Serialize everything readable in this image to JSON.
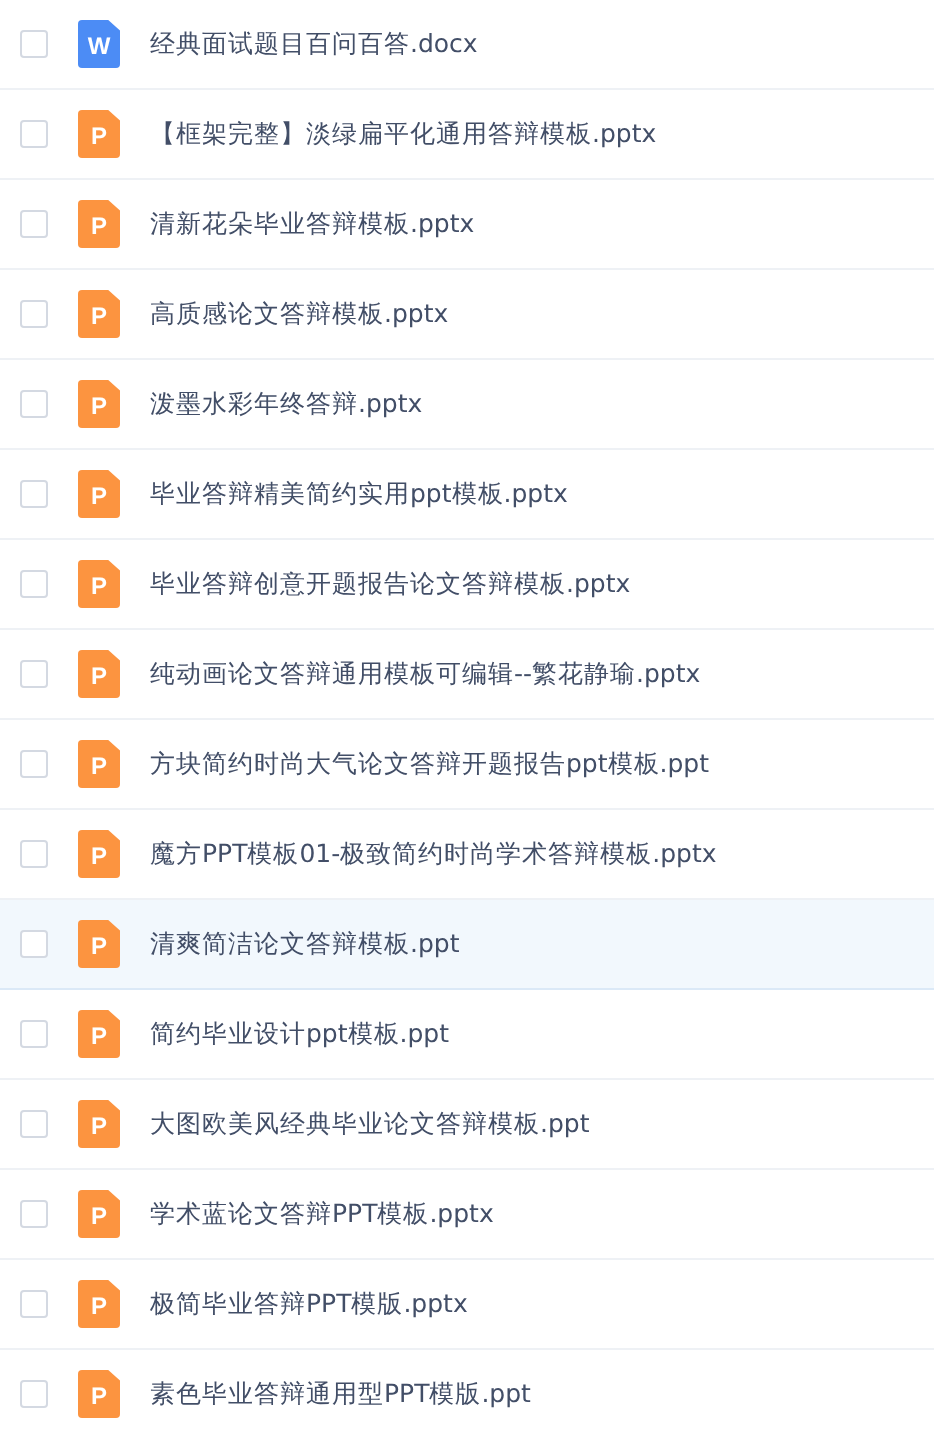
{
  "files": [
    {
      "name": "经典面试题目百问百答.docx",
      "kind": "word",
      "badge": "W",
      "checked": false,
      "selected": false
    },
    {
      "name": "【框架完整】淡绿扁平化通用答辩模板.pptx",
      "kind": "ppt",
      "badge": "P",
      "checked": false,
      "selected": false
    },
    {
      "name": "清新花朵毕业答辩模板.pptx",
      "kind": "ppt",
      "badge": "P",
      "checked": false,
      "selected": false
    },
    {
      "name": "高质感论文答辩模板.pptx",
      "kind": "ppt",
      "badge": "P",
      "checked": false,
      "selected": false
    },
    {
      "name": "泼墨水彩年终答辩.pptx",
      "kind": "ppt",
      "badge": "P",
      "checked": false,
      "selected": false
    },
    {
      "name": "毕业答辩精美简约实用ppt模板.pptx",
      "kind": "ppt",
      "badge": "P",
      "checked": false,
      "selected": false
    },
    {
      "name": "毕业答辩创意开题报告论文答辩模板.pptx",
      "kind": "ppt",
      "badge": "P",
      "checked": false,
      "selected": false
    },
    {
      "name": "纯动画论文答辩通用模板可编辑--繁花静瑜.pptx",
      "kind": "ppt",
      "badge": "P",
      "checked": false,
      "selected": false
    },
    {
      "name": "方块简约时尚大气论文答辩开题报告ppt模板.ppt",
      "kind": "ppt",
      "badge": "P",
      "checked": false,
      "selected": false
    },
    {
      "name": "魔方PPT模板01-极致简约时尚学术答辩模板.pptx",
      "kind": "ppt",
      "badge": "P",
      "checked": false,
      "selected": false
    },
    {
      "name": "清爽简洁论文答辩模板.ppt",
      "kind": "ppt",
      "badge": "P",
      "checked": false,
      "selected": true
    },
    {
      "name": "简约毕业设计ppt模板.ppt",
      "kind": "ppt",
      "badge": "P",
      "checked": false,
      "selected": false
    },
    {
      "name": "大图欧美风经典毕业论文答辩模板.ppt",
      "kind": "ppt",
      "badge": "P",
      "checked": false,
      "selected": false
    },
    {
      "name": "学术蓝论文答辩PPT模板.pptx",
      "kind": "ppt",
      "badge": "P",
      "checked": false,
      "selected": false
    },
    {
      "name": "极简毕业答辩PPT模版.pptx",
      "kind": "ppt",
      "badge": "P",
      "checked": false,
      "selected": false
    },
    {
      "name": "素色毕业答辩通用型PPT模版.ppt",
      "kind": "ppt",
      "badge": "P",
      "checked": false,
      "selected": false
    }
  ]
}
